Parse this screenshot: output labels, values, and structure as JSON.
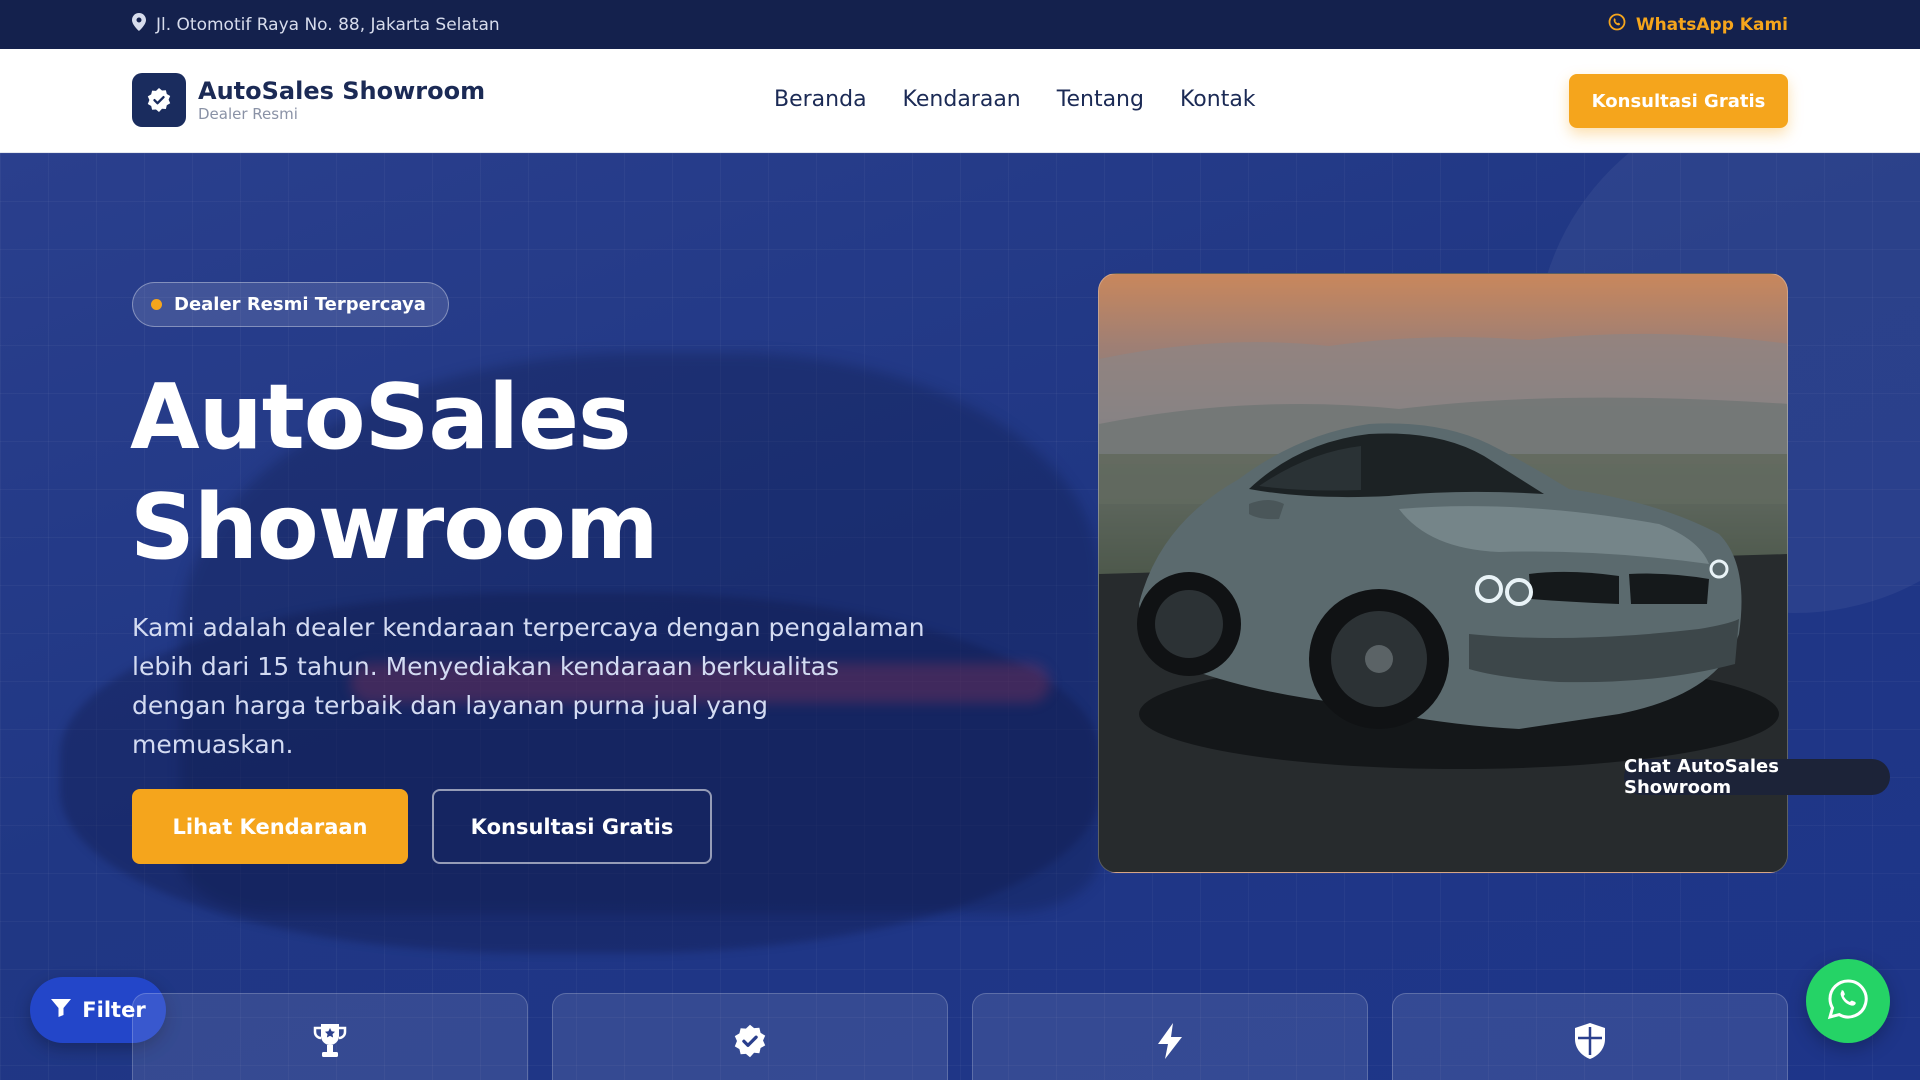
{
  "topbar": {
    "address": "Jl. Otomotif Raya No. 88, Jakarta Selatan",
    "whatsapp_label": "WhatsApp Kami"
  },
  "header": {
    "brand_title": "AutoSales Showroom",
    "brand_subtitle": "Dealer Resmi",
    "nav": [
      "Beranda",
      "Kendaraan",
      "Tentang",
      "Kontak"
    ],
    "cta_label": "Konsultasi Gratis"
  },
  "hero": {
    "badge": "Dealer Resmi Terpercaya",
    "title_line1": "AutoSales",
    "title_line2": "Showroom",
    "description": "Kami adalah dealer kendaraan terpercaya dengan pengalaman lebih dari 15 tahun. Menyediakan kendaraan berkualitas dengan harga terbaik dan layanan purna jual yang memuaskan.",
    "primary_button": "Lihat Kendaraan",
    "secondary_button": "Konsultasi Gratis"
  },
  "floating": {
    "filter_label": "Filter",
    "chat_label": "Chat AutoSales Showroom"
  },
  "feature_cards": [
    {
      "icon": "trophy-icon",
      "value": ""
    },
    {
      "icon": "verified-badge-icon",
      "value": ""
    },
    {
      "icon": "lightning-icon",
      "value": ""
    },
    {
      "icon": "shield-icon",
      "value": ""
    }
  ],
  "colors": {
    "navy": "#14214d",
    "accent": "#f5a51c",
    "hero_blue": "#203784",
    "whatsapp_green": "#25d366",
    "filter_blue": "#2346c9"
  }
}
